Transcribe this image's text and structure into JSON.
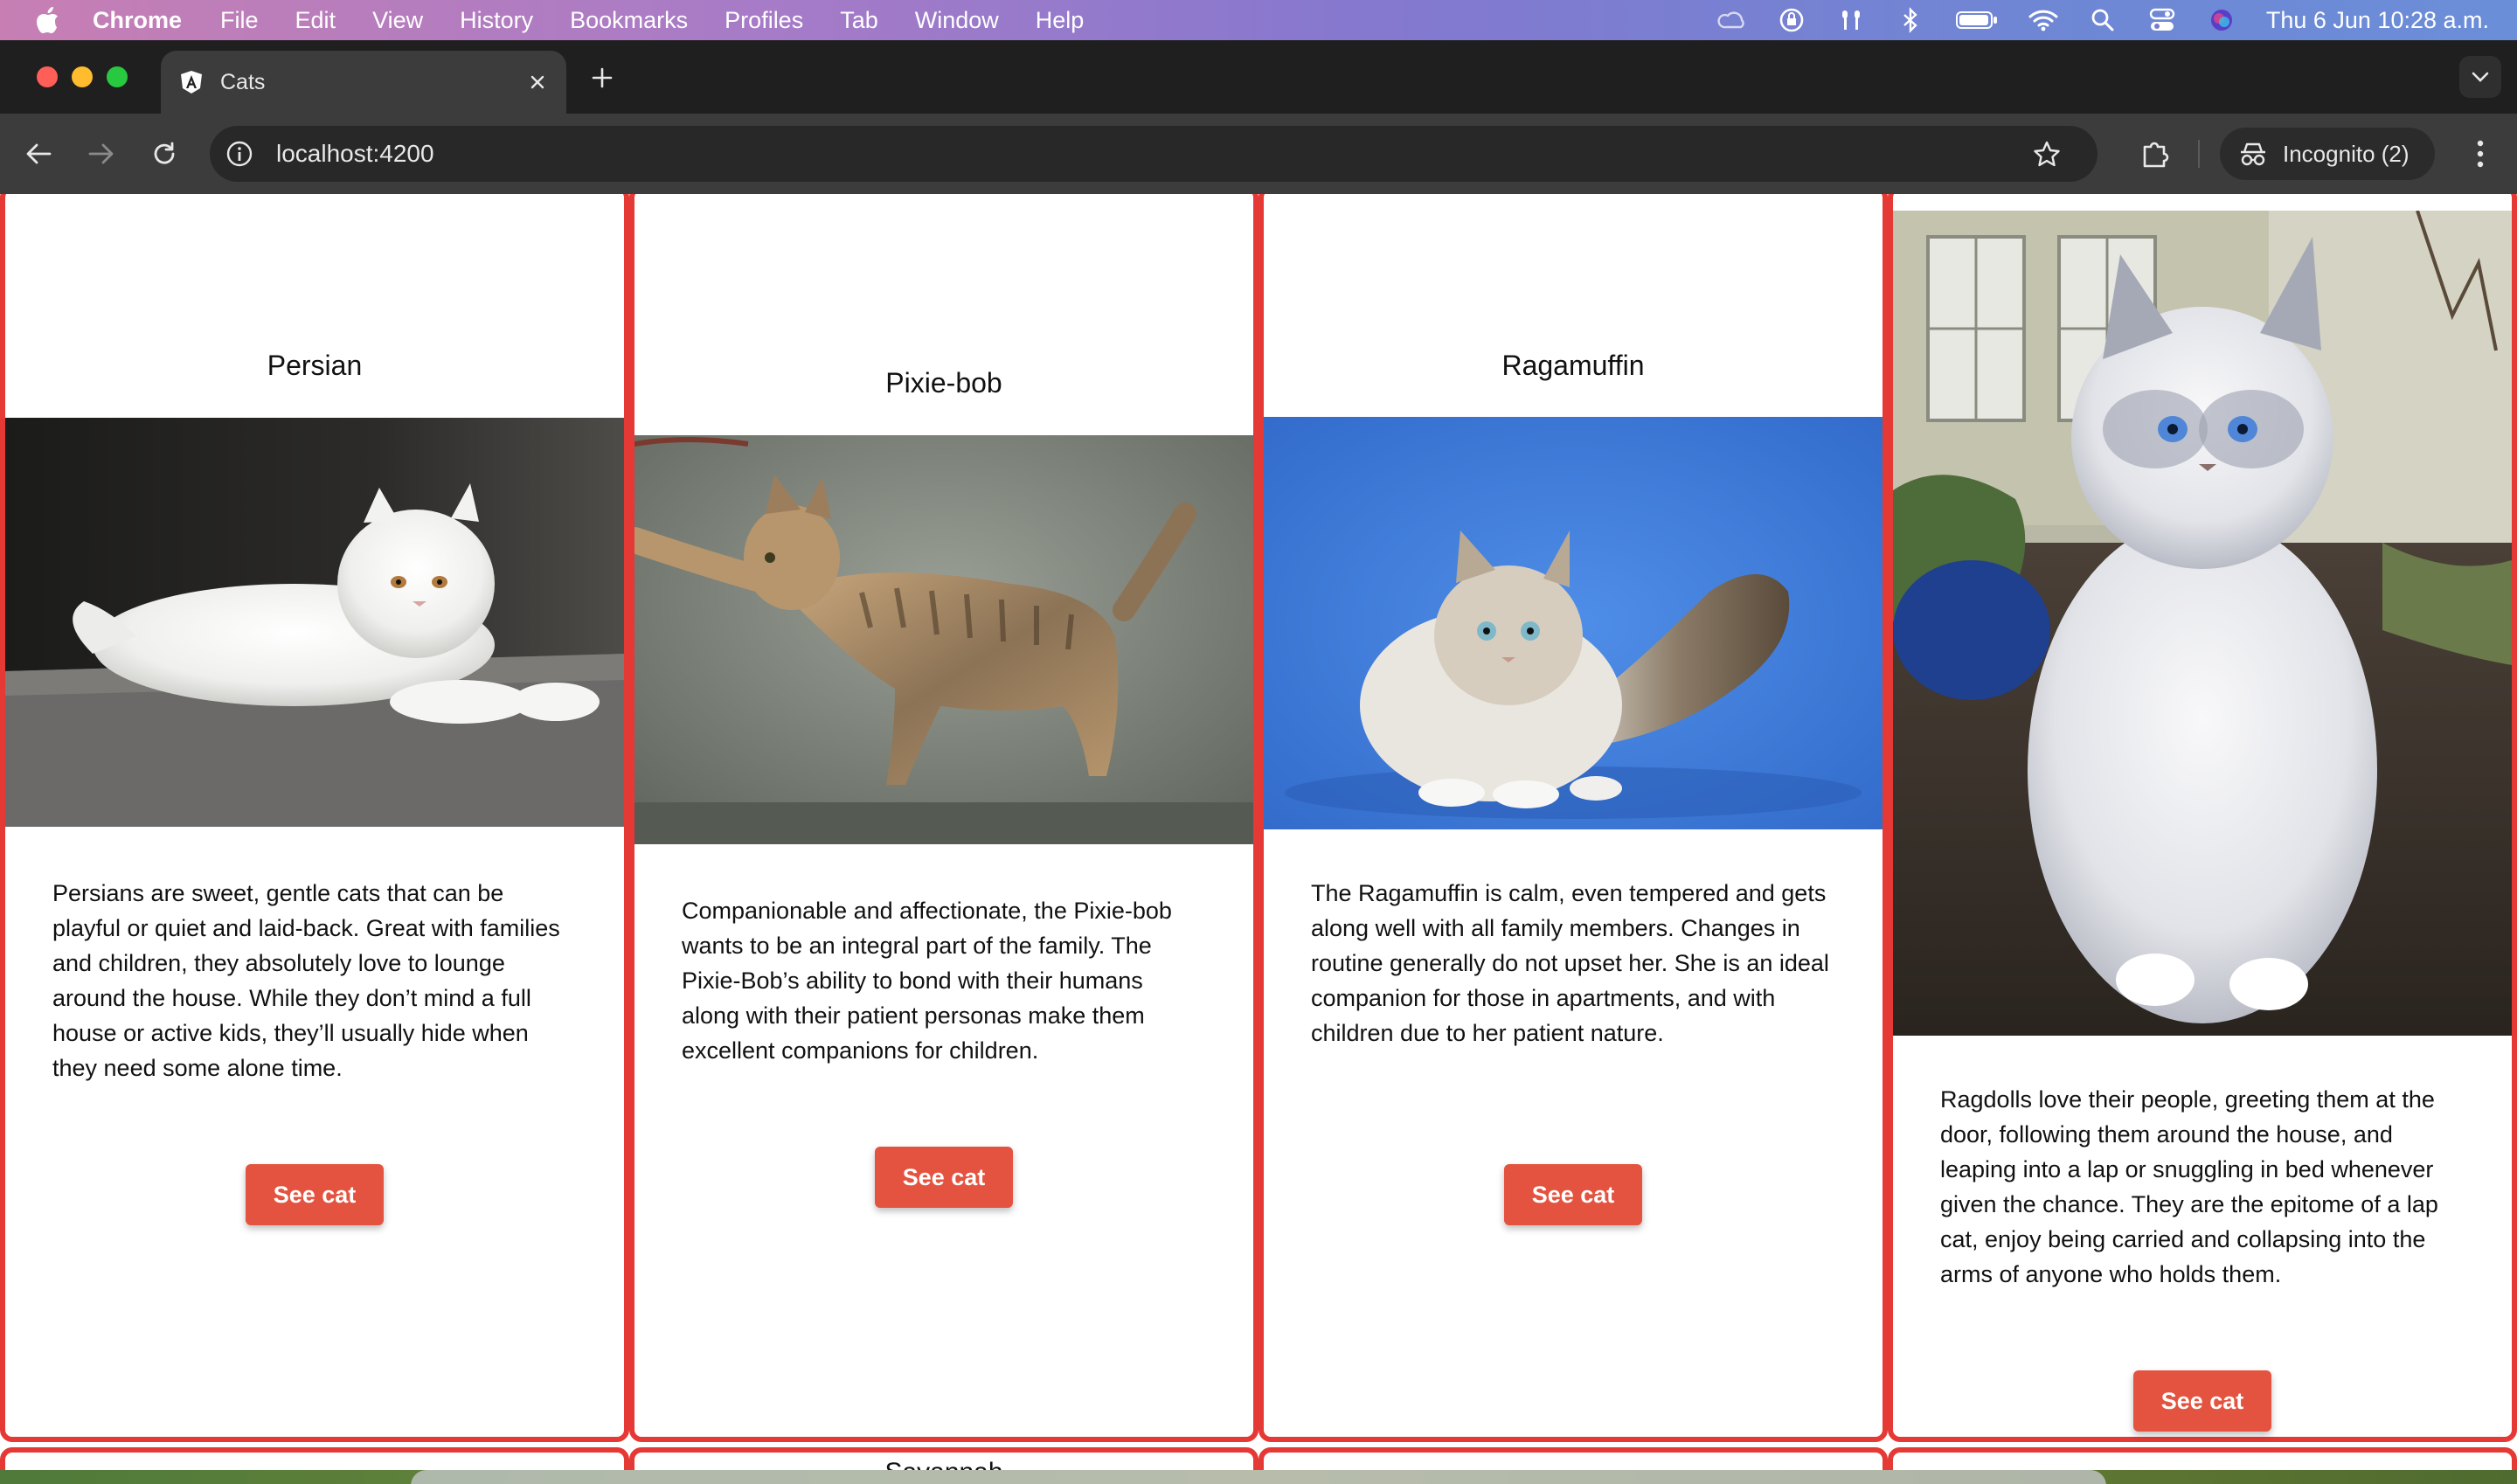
{
  "menubar": {
    "app_name": "Chrome",
    "items": [
      "File",
      "Edit",
      "View",
      "History",
      "Bookmarks",
      "Profiles",
      "Tab",
      "Window",
      "Help"
    ],
    "clock": "Thu 6 Jun  10:28 a.m.",
    "status_icons": [
      "creative-cloud-icon",
      "vpn-icon",
      "airpods-icon",
      "bluetooth-icon",
      "battery-icon",
      "wifi-icon",
      "spotlight-icon",
      "control-center-icon",
      "siri-icon"
    ]
  },
  "browser": {
    "tab_title": "Cats",
    "url": "localhost:4200",
    "profile_label": "Incognito (2)"
  },
  "cards": [
    {
      "title": "Persian",
      "description": "Persians are sweet, gentle cats that can be playful or quiet and laid-back. Great with families and children, they absolutely love to lounge around the house. While they don’t mind a full house or active kids, they’ll usually hide when they need some alone time.",
      "button": "See cat",
      "photo": "white-persian-cat-photo"
    },
    {
      "title": "Pixie-bob",
      "description": "Companionable and affectionate, the Pixie-bob wants to be an integral part of the family. The Pixie-Bob’s ability to bond with their humans along with their patient personas make them excellent companions for children.",
      "button": "See cat",
      "photo": "tabby-pixie-bob-cat-photo"
    },
    {
      "title": "Ragamuffin",
      "description": "The Ragamuffin is calm, even tempered and gets along well with all family members. Changes in routine generally do not upset her. She is an ideal companion for those in apartments, and with children due to her patient nature.",
      "button": "See cat",
      "photo": "ragamuffin-cat-photo"
    },
    {
      "title": "",
      "description": "Ragdolls love their people, greeting them at the door, following them around the house, and leaping into a lap or snuggling in bed whenever given the chance. They are the epitome of a lap cat, enjoy being carried and collapsing into the arms of anyone who holds them.",
      "button": "See cat",
      "photo": "ragdoll-cat-photo"
    }
  ],
  "next_row_peek": "Savannah",
  "colors": {
    "card_border": "#e53935",
    "button_bg": "#e4533f"
  }
}
